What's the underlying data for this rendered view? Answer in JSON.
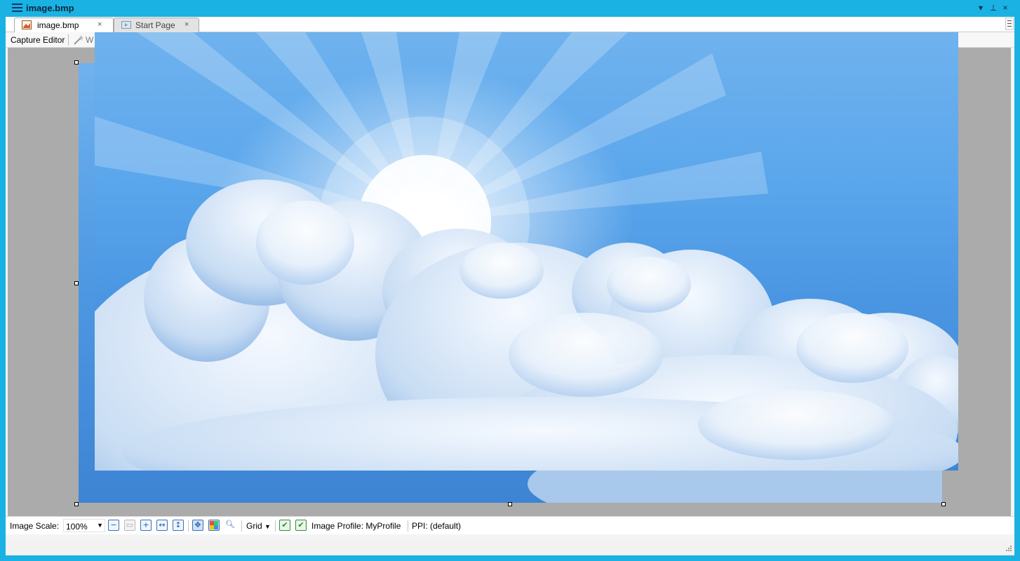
{
  "window": {
    "title": "image.bmp",
    "pin_glyph": "⊥",
    "close_glyph": "×",
    "dropdown_glyph": "▾"
  },
  "tabs": [
    {
      "label": "image.bmp",
      "icon": "bitmap-file-icon",
      "close": "×",
      "active": true
    },
    {
      "label": "Start Page",
      "icon": "start-page-icon",
      "close": "×",
      "active": false
    }
  ],
  "command_bar": {
    "capture_editor_label": "Capture Editor",
    "truncated_command_label": "W"
  },
  "status_bar": {
    "image_scale_label": "Image Scale:",
    "image_scale_value": "100%",
    "grid_label": "Grid",
    "image_profile_text": "Image Profile: MyProfile",
    "ppi_text": "PPI: (default)"
  },
  "colors": {
    "title_bar": "#1ab2e2",
    "canvas_background": "#ababab",
    "sky_blue": "#4b96e2"
  }
}
